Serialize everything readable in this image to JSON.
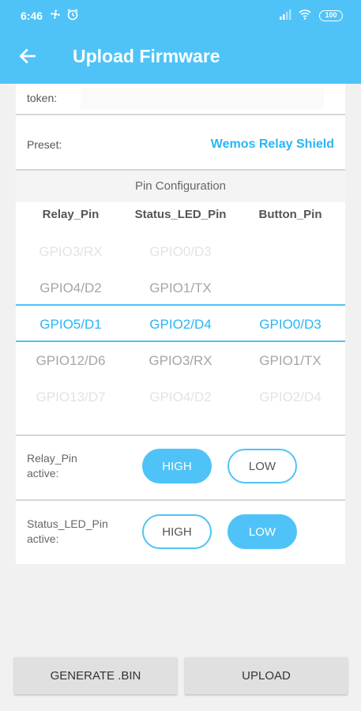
{
  "status_bar": {
    "time": "6:46",
    "battery": "100"
  },
  "app_bar": {
    "title": "Upload Firmware"
  },
  "token": {
    "label": "token:",
    "value": ""
  },
  "preset": {
    "label": "Preset:",
    "value": "Wemos Relay Shield"
  },
  "pin_config": {
    "header": "Pin Configuration",
    "columns": [
      {
        "name": "Relay_Pin",
        "items": [
          "GPIO3/RX",
          "GPIO4/D2",
          "GPIO5/D1",
          "GPIO12/D6",
          "GPIO13/D7"
        ],
        "selected": "GPIO5/D1"
      },
      {
        "name": "Status_LED_Pin",
        "items": [
          "GPIO0/D3",
          "GPIO1/TX",
          "GPIO2/D4",
          "GPIO3/RX",
          "GPIO4/D2"
        ],
        "selected": "GPIO2/D4"
      },
      {
        "name": "Button_Pin",
        "items": [
          "",
          "",
          "GPIO0/D3",
          "GPIO1/TX",
          "GPIO2/D4"
        ],
        "selected": "GPIO0/D3"
      }
    ]
  },
  "relay_active": {
    "label": "Relay_Pin\nactive:",
    "high": "HIGH",
    "low": "LOW",
    "selected": "HIGH"
  },
  "status_led_active": {
    "label": "Status_LED_Pin\nactive:",
    "high": "HIGH",
    "low": "LOW",
    "selected": "LOW"
  },
  "actions": {
    "generate": "GENERATE .BIN",
    "upload": "UPLOAD"
  },
  "colors": {
    "accent": "#4fc3f7",
    "accent_text": "#29b6f6",
    "background": "#f1f1f1"
  }
}
